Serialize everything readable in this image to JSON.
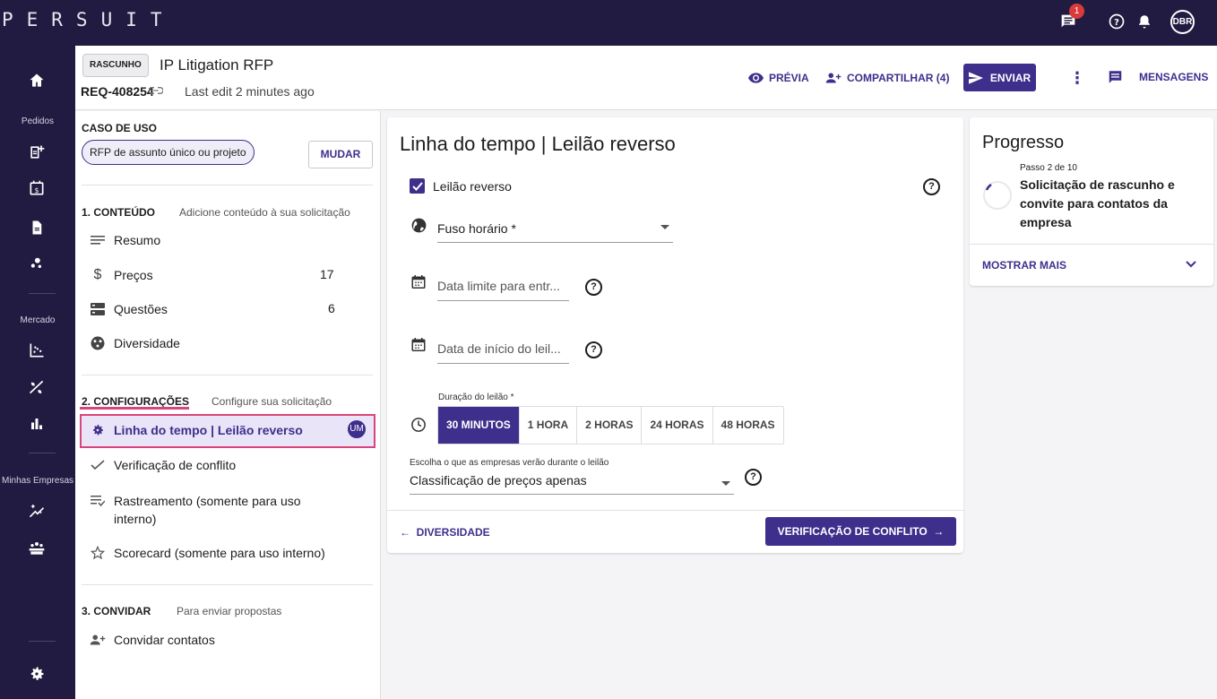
{
  "app": {
    "logo": "PERSUIT",
    "notification_count": "1",
    "user_initials": "DBR"
  },
  "rail": {
    "section_orders": "Pedidos",
    "section_market": "Mercado",
    "section_companies": "Minhas Empresas"
  },
  "header": {
    "status_badge": "RASCUNHO",
    "title": "IP Litigation RFP",
    "req_id": "REQ-408254",
    "last_edit": "Last edit 2 minutes ago",
    "preview_label": "PRÉVIA",
    "share_label": "COMPARTILHAR (4)",
    "send_label": "ENVIAR",
    "messages_label": "MENSAGENS"
  },
  "sidebar": {
    "use_case_title": "CASO DE USO",
    "use_case_chip": "RFP de assunto único ou projeto",
    "change_label": "MUDAR",
    "content_title": "1. CONTEÚDO",
    "content_sub": "Adicione conteúdo à sua solicitação",
    "content_items": [
      {
        "label": "Resumo",
        "icon": "lines-icon",
        "count": ""
      },
      {
        "label": "Preços",
        "icon": "dollar-icon",
        "count": "17"
      },
      {
        "label": "Questões",
        "icon": "questions-icon",
        "count": "6"
      },
      {
        "label": "Diversidade",
        "icon": "diversity-icon",
        "count": ""
      }
    ],
    "settings_title": "2. CONFIGURAÇÕES",
    "settings_sub": "Configure sua solicitação",
    "settings_items": [
      {
        "label": "Linha do tempo | Leilão reverso",
        "icon": "gear-icon",
        "active": true,
        "avatar": "UM"
      },
      {
        "label": "Verificação de conflito",
        "icon": "check-icon"
      },
      {
        "label": "Rastreamento (somente para uso",
        "label2": "interno)",
        "icon": "tracking-icon"
      },
      {
        "label": "Scorecard (somente para uso interno)",
        "icon": "star-icon"
      }
    ],
    "invite_title": "3. CONVIDAR",
    "invite_sub": "Para enviar propostas",
    "invite_item": "Convidar contatos"
  },
  "main": {
    "title": "Linha do tempo | Leilão reverso",
    "reverse_auction_label": "Leilão reverso",
    "reverse_auction_checked": true,
    "timezone_label": "Fuso horário *",
    "deadline_placeholder": "Data limite para entr...",
    "start_date_placeholder": "Data de início do leil...",
    "duration_label": "Duração do leilão *",
    "durations": [
      "30 MINUTOS",
      "1 HORA",
      "2 HORAS",
      "24 HORAS",
      "48 HORAS"
    ],
    "selected_duration": "30 MINUTOS",
    "visibility_label": "Escolha o que as empresas verão durante o leilão",
    "visibility_value": "Classificação de preços apenas",
    "back_label": "DIVERSIDADE",
    "next_label": "VERIFICAÇÃO DE CONFLITO"
  },
  "progress": {
    "title": "Progresso",
    "step": "Passo 2 de 10",
    "current": "Solicitação de rascunho e convite para contatos da empresa",
    "show_more": "MOSTRAR MAIS"
  },
  "colors": {
    "brand_dark": "#221b41",
    "accent": "#3e2f8c",
    "highlight": "#d8457a"
  }
}
